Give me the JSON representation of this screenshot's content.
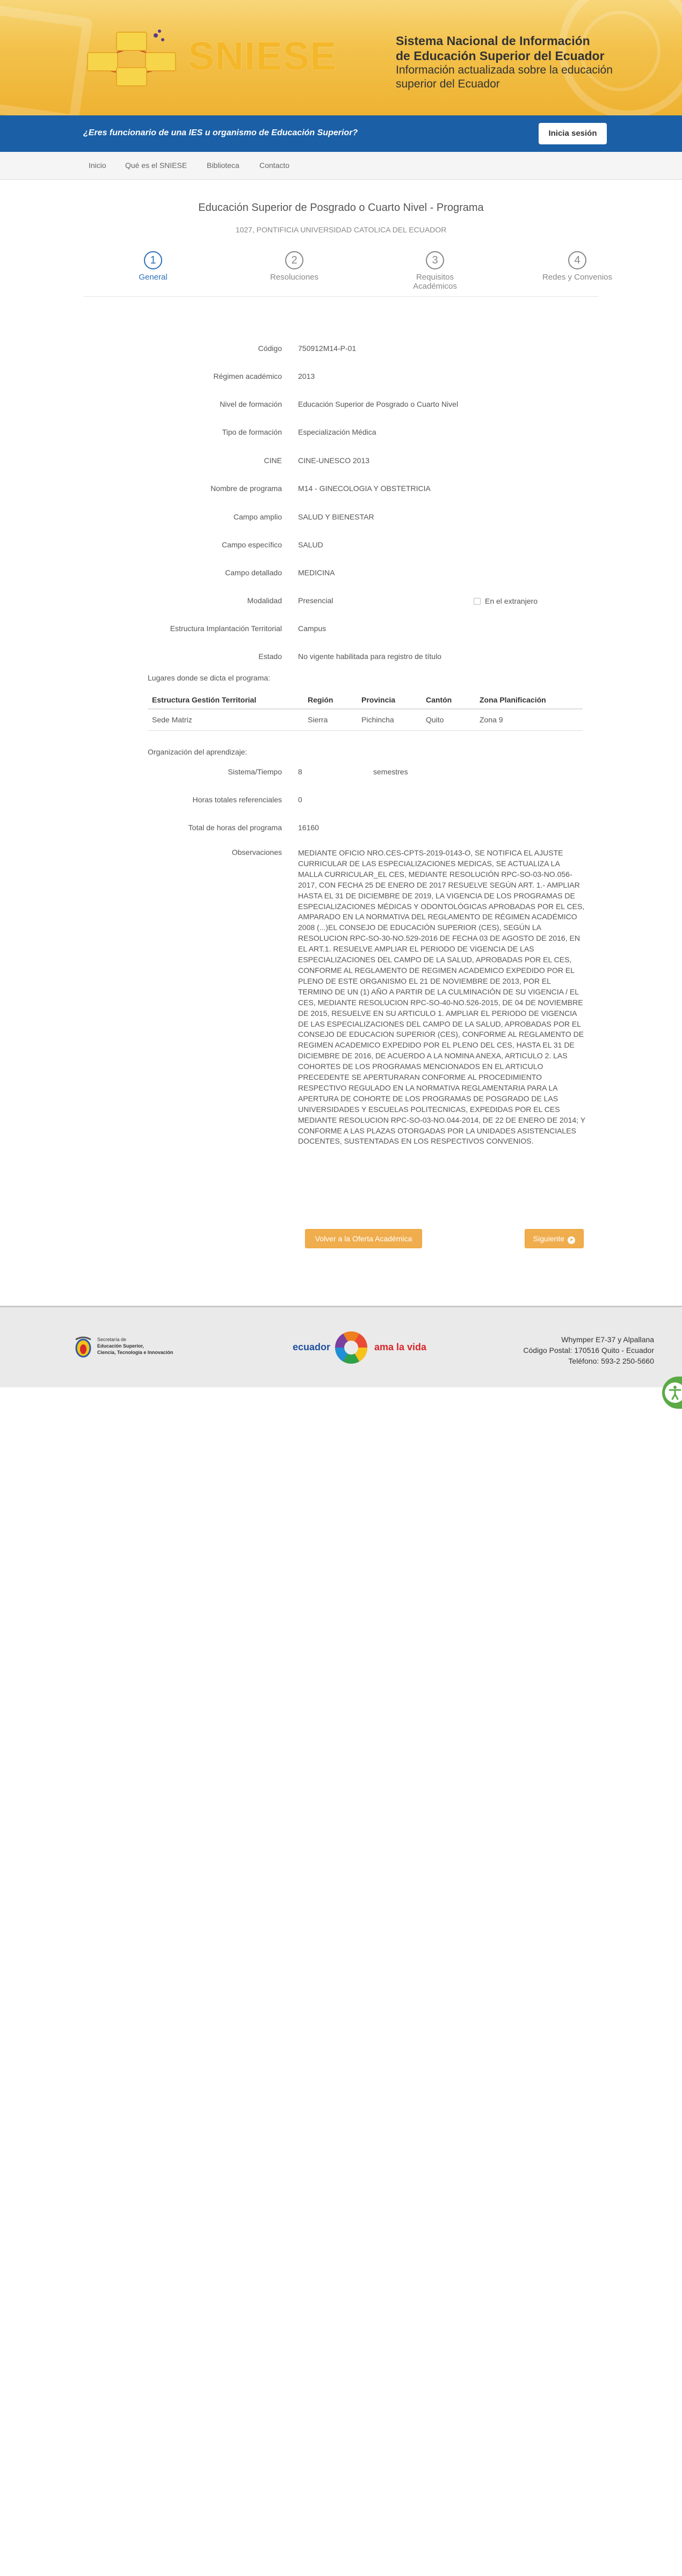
{
  "header": {
    "logo_text": "SNIESE",
    "title_line1": "Sistema Nacional de Información",
    "title_line2": "de Educación Superior del Ecuador",
    "subtitle_line1": "Información actualizada sobre la educación",
    "subtitle_line2": "superior del Ecuador"
  },
  "bluebar": {
    "question": "¿Eres funcionario de una IES u organismo de Educación Superior?",
    "login_label": "Inicia sesión"
  },
  "nav": {
    "items": [
      "Inicio",
      "Qué es el SNIESE",
      "Biblioteca",
      "Contacto"
    ]
  },
  "page": {
    "title": "Educación Superior de Posgrado o Cuarto Nivel - Programa",
    "subtitle": "1027, PONTIFICIA UNIVERSIDAD CATOLICA DEL ECUADOR"
  },
  "steps": [
    {
      "number": "1",
      "label": "General",
      "active": true
    },
    {
      "number": "2",
      "label": "Resoluciones",
      "active": false
    },
    {
      "number": "3",
      "label": "Requisitos Académicos",
      "active": false
    },
    {
      "number": "4",
      "label": "Redes y Convenios",
      "active": false
    }
  ],
  "fields": [
    {
      "label": "Código",
      "value": "750912M14-P-01"
    },
    {
      "label": "Régimen académico",
      "value": "2013"
    },
    {
      "label": "Nivel de formación",
      "value": "Educación Superior de Posgrado o Cuarto Nivel"
    },
    {
      "label": "Tipo de formación",
      "value": "Especialización Médica"
    },
    {
      "label": "CINE",
      "value": "CINE-UNESCO 2013"
    },
    {
      "label": "Nombre de programa",
      "value": "M14 - GINECOLOGIA Y OBSTETRICIA"
    },
    {
      "label": "Campo amplio",
      "value": "SALUD Y BIENESTAR"
    },
    {
      "label": "Campo específico",
      "value": "SALUD"
    },
    {
      "label": "Campo detallado",
      "value": "MEDICINA"
    },
    {
      "label": "Modalidad",
      "value": "Presencial"
    },
    {
      "label": "Estructura Implantación Territorial",
      "value": "Campus"
    },
    {
      "label": "Estado",
      "value": "No vigente habilitada para registro de título"
    }
  ],
  "extranjero_label": "En el extranjero",
  "locations": {
    "section_label": "Lugares donde se dicta el programa:",
    "headers": [
      "Estructura Gestión Territorial",
      "Región",
      "Provincia",
      "Cantón",
      "Zona Planificación"
    ],
    "rows": [
      [
        "Sede Matriz",
        "Sierra",
        "Pichincha",
        "Quito",
        "Zona 9"
      ]
    ]
  },
  "learning": {
    "section_label": "Organización del aprendizaje:",
    "sistema_label": "Sistema/Tiempo",
    "sistema_value": "8",
    "sistema_unit": "semestres",
    "horas_ref_label": "Horas totales referenciales",
    "horas_ref_value": "0",
    "horas_total_label": "Total de horas del programa",
    "horas_total_value": "16160"
  },
  "observaciones": {
    "label": "Observaciones",
    "text": "MEDIANTE OFICIO NRO.CES-CPTS-2019-0143-O, SE NOTIFICA EL AJUSTE CURRICULAR DE LAS ESPECIALIZACIONES MEDICAS, SE ACTUALIZA LA MALLA CURRICULAR_EL CES, MEDIANTE RESOLUCIÓN RPC-SO-03-No.056-2017, CON FECHA 25 DE ENERO DE 2017 RESUELVE SEGÚN ART. 1.- AMPLIAR HASTA EL 31 DE DICIEMBRE DE 2019, LA VIGENCIA DE LOS PROGRAMAS DE ESPECIALIZACIONES MÉDICAS Y ODONTOLÓGICAS APROBADAS POR EL CES, AMPARADO EN LA NORMATIVA DEL REGLAMENTO DE RÉGIMEN ACADÉMICO 2008 (...)EL CONSEJO DE EDUCACIÓN SUPERIOR (CES), SEGÚN LA RESOLUCION RPC-SO-30-No.529-2016 DE FECHA 03 DE AGOSTO DE 2016, EN EL ART.1. RESUELVE AMPLIAR EL PERIODO DE VIGENCIA DE LAS ESPECIALIZACIONES DEL CAMPO DE LA SALUD, APROBADAS POR EL CES, CONFORME AL REGLAMENTO DE REGIMEN ACADEMICO EXPEDIDO POR EL PLENO DE ESTE ORGANISMO EL 21 DE NOVIEMBRE DE 2013, POR EL TERMINO DE UN (1) AÑO A PARTIR DE LA CULMINACIÓN DE SU VIGENCIA / EL CES, MEDIANTE RESOLUCION RPC-SO-40-No.526-2015, DE 04 DE NOVIEMBRE DE 2015, RESUELVE EN SU ARTICULO 1. AMPLIAR EL PERIODO DE VIGENCIA DE LAS ESPECIALIZACIONES DEL CAMPO DE LA SALUD, APROBADAS POR EL CONSEJO DE EDUCACION SUPERIOR (CES), CONFORME AL REGLAMENTO DE REGIMEN ACADEMICO EXPEDIDO POR EL PLENO DEL CES, HASTA EL 31 DE DICIEMBRE DE 2016, DE ACUERDO A LA NOMINA ANEXA, ARTICULO 2. LAS COHORTES DE LOS PROGRAMAS MENCIONADOS EN EL ARTICULO PRECEDENTE SE APERTURARAN CONFORME AL PROCEDIMIENTO RESPECTIVO REGULADO EN LA NORMATIVA REGLAMENTARIA PARA LA APERTURA DE COHORTE DE LOS PROGRAMAS DE POSGRADO DE LAS UNIVERSIDADES Y ESCUELAS POLITECNICAS, EXPEDIDAS POR EL CES MEDIANTE RESOLUCION RPC-SO-03-No.044-2014, DE 22 DE ENERO DE 2014; Y CONFORME A LAS PLAZAS OTORGADAS POR LA UNIDADES ASISTENCIALES DOCENTES, SUSTENTADAS EN LOS RESPECTIVOS CONVENIOS."
  },
  "buttons": {
    "back_label": "Volver a la Oferta Académica",
    "next_label": "Siguiente"
  },
  "footer": {
    "logo1_line1": "Secretaría de",
    "logo1_line2": "Educación Superior,",
    "logo1_line3": "Ciencia, Tecnología e Innovación",
    "logo2_left": "ecuador",
    "logo2_right": "ama la vida",
    "address_line1": "Whymper E7-37 y Alpallana",
    "address_line2": "Código Postal: 170516 Quito - Ecuador",
    "address_line3": "Teléfono: 593-2 250-5660"
  },
  "colors": {
    "banner_yellow": "#f3c24c",
    "blue_bar": "#1b5fa6",
    "active_step": "#2a6fba",
    "orange_button": "#f0ad4e",
    "accessibility_green": "#5aaa46"
  }
}
